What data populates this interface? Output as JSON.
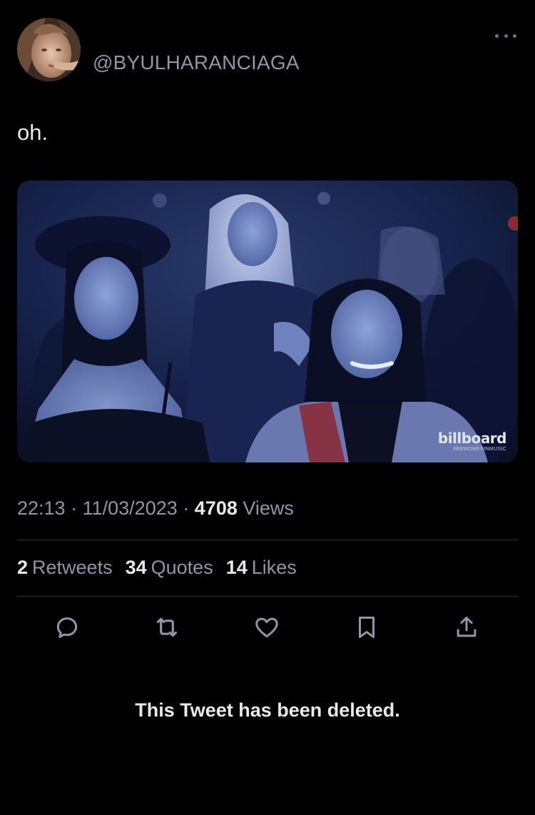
{
  "tweet": {
    "handle": "@BYULHARANCIAGA",
    "text": "oh.",
    "media": {
      "watermark_brand": "billboard",
      "watermark_tag": "#BBWOMENINMUSIC"
    },
    "time": "22:13",
    "separator": "·",
    "date": "11/03/2023",
    "views_count": "4708",
    "views_label": "Views"
  },
  "stats": {
    "retweets_count": "2",
    "retweets_label": "Retweets",
    "quotes_count": "34",
    "quotes_label": "Quotes",
    "likes_count": "14",
    "likes_label": "Likes"
  },
  "actions": [
    "reply-icon",
    "retweet-icon",
    "like-icon",
    "bookmark-icon",
    "share-icon"
  ],
  "notice": "This Tweet has been deleted.",
  "colors": {
    "background": "#000000",
    "primary_text": "#e7e9ea",
    "secondary_text": "#8b98a5",
    "divider": "#2f3336"
  }
}
